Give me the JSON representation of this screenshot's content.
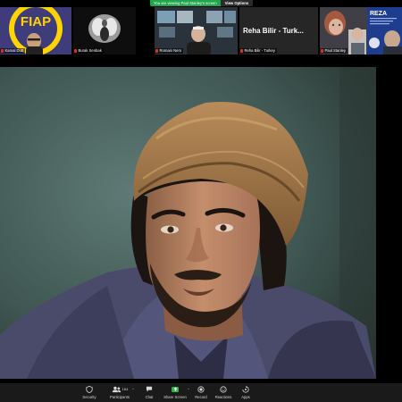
{
  "notice": {
    "text": "You are viewing Paul Stanley's screen",
    "button": "View Options"
  },
  "participants": [
    {
      "name": "Kamal Dutt",
      "bg": "#3d3c7a"
    },
    {
      "name": "Burak Senbak",
      "bg": "#0f0f0f"
    },
    {
      "name": "Romain Nero",
      "bg": "#26313a"
    },
    {
      "name": "Reha Bilir - Turkey",
      "display": "Reha Bilir - Turk...",
      "bg": "#262626"
    },
    {
      "name": "Paul Stanley",
      "bg": "#3a3a44"
    },
    {
      "name": "REZA",
      "bg": "#1d3c8c"
    }
  ],
  "toolbar": {
    "items": [
      {
        "label": "Security",
        "icon": "shield-icon"
      },
      {
        "label": "Participants",
        "icon": "participants-icon",
        "count": "164"
      },
      {
        "label": "Chat",
        "icon": "chat-icon"
      },
      {
        "label": "Share Screen",
        "icon": "share-screen-icon"
      },
      {
        "label": "Record",
        "icon": "record-icon"
      },
      {
        "label": "Reactions",
        "icon": "reactions-icon"
      },
      {
        "label": "Apps",
        "icon": "apps-icon"
      }
    ]
  },
  "colors": {
    "share_green": "#27b345",
    "notice_green": "#1fa54b",
    "mute_red": "#e0301e"
  }
}
